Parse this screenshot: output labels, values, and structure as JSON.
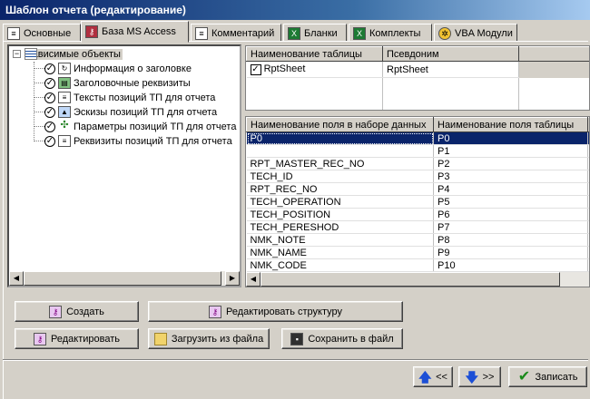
{
  "window": {
    "title": "Шаблон отчета (редактирование)"
  },
  "tabs": [
    {
      "label": "Основные",
      "icon": "document-icon",
      "active": false
    },
    {
      "label": "База MS Access",
      "icon": "access-key-icon",
      "active": true
    },
    {
      "label": "Комментарий",
      "icon": "comment-document-icon",
      "active": false
    },
    {
      "label": "Бланки",
      "icon": "excel-icon",
      "active": false
    },
    {
      "label": "Комплекты",
      "icon": "excel-icon",
      "active": false
    },
    {
      "label": "VBA Модули",
      "icon": "vba-gear-icon",
      "active": false
    }
  ],
  "tree": {
    "root": {
      "label": "Зависимые объекты",
      "expander": "−",
      "icon": "table-grid-icon"
    },
    "items": [
      {
        "label": "Информация о заголовке",
        "checked": true,
        "icon": "header-info-icon"
      },
      {
        "label": "Заголовочные реквизиты",
        "checked": true,
        "icon": "header-attributes-icon"
      },
      {
        "label": "Тексты позиций ТП для отчета",
        "checked": true,
        "icon": "text-document-icon"
      },
      {
        "label": "Эскизы позиций ТП для отчета",
        "checked": true,
        "icon": "sketch-image-icon"
      },
      {
        "label": "Параметры позиций ТП для отчета",
        "checked": true,
        "icon": "parameters-icon"
      },
      {
        "label": "Реквизиты позиций ТП для отчета",
        "checked": true,
        "icon": "document-icon"
      }
    ]
  },
  "tables_grid": {
    "columns": [
      "Наименование таблицы",
      "Псевдоним"
    ],
    "rows": [
      {
        "name": "RptSheet",
        "alias": "RptSheet",
        "checked": true
      }
    ]
  },
  "fields_grid": {
    "columns": [
      "Наименование поля в наборе данных",
      "Наименование поля таблицы"
    ],
    "rows": [
      {
        "field": "P0",
        "column": "P0",
        "selected": true
      },
      {
        "field": "",
        "column": "P1"
      },
      {
        "field": "RPT_MASTER_REC_NO",
        "column": "P2"
      },
      {
        "field": "TECH_ID",
        "column": "P3"
      },
      {
        "field": "RPT_REC_NO",
        "column": "P4"
      },
      {
        "field": "TECH_OPERATION",
        "column": "P5"
      },
      {
        "field": "TECH_POSITION",
        "column": "P6"
      },
      {
        "field": "TECH_PERESHOD",
        "column": "P7"
      },
      {
        "field": "NMK_NOTE",
        "column": "P8"
      },
      {
        "field": "NMK_NAME",
        "column": "P9"
      },
      {
        "field": "NMK_CODE",
        "column": "P10"
      }
    ]
  },
  "buttons": {
    "create": "Создать",
    "edit_structure": "Редактировать структуру",
    "edit": "Редактировать",
    "load_file": "Загрузить из файла",
    "save_file": "Сохранить в файл",
    "prev": "<<",
    "next": ">>",
    "save": "Записать"
  },
  "colors": {
    "titlebar": "#0a246a",
    "selection": "#0a246a",
    "face": "#d4d0c8"
  }
}
